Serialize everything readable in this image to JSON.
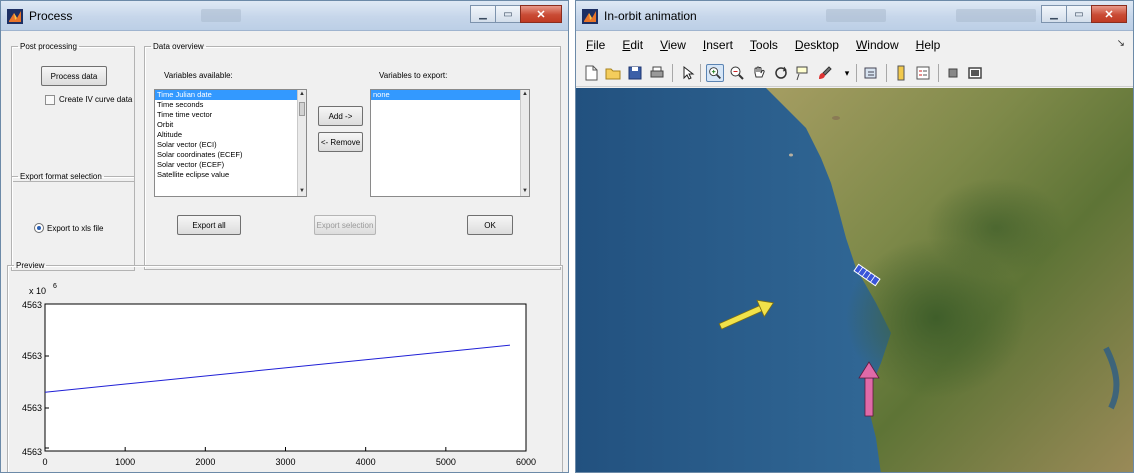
{
  "process": {
    "title": "Process",
    "post_processing": {
      "legend": "Post processing",
      "process_btn": "Process data",
      "iv_checkbox": "Create IV curve data"
    },
    "export_format": {
      "legend": "Export format selection",
      "xls_radio": "Export to xls file"
    },
    "data_overview": {
      "legend": "Data overview",
      "available_label": "Variables available:",
      "export_label": "Variables to export:",
      "available_items": [
        "Time Julian date",
        "Time seconds",
        "Time time vector",
        "Orbit",
        "Altitude",
        "Solar vector (ECI)",
        "Solar coordinates (ECEF)",
        "Solar vector (ECEF)",
        "Satellite eclipse value"
      ],
      "export_items": [
        "none"
      ],
      "add_btn": "Add ->",
      "remove_btn": "<- Remove",
      "export_all_btn": "Export all",
      "export_selection_btn": "Export selection",
      "ok_btn": "OK"
    },
    "preview": {
      "legend": "Preview",
      "exponent_base": "x 10",
      "exponent_power": "6",
      "ytick_labels": [
        "4563",
        "4563",
        "4563",
        "4563"
      ],
      "xtick_labels": [
        "0",
        "1000",
        "2000",
        "3000",
        "4000",
        "5000",
        "6000"
      ]
    }
  },
  "chart_data": {
    "type": "line",
    "x": [
      0,
      5800
    ],
    "y": [
      0.4,
      0.72
    ],
    "xlim": [
      0,
      6000
    ],
    "ylim": [
      0,
      1
    ],
    "line_color": "#1f1fd6",
    "grid": false
  },
  "animation": {
    "title": "In-orbit animation",
    "menus": [
      {
        "underline": "F",
        "rest": "ile"
      },
      {
        "underline": "E",
        "rest": "dit"
      },
      {
        "underline": "V",
        "rest": "iew"
      },
      {
        "underline": "I",
        "rest": "nsert"
      },
      {
        "underline": "T",
        "rest": "ools"
      },
      {
        "underline": "D",
        "rest": "esktop"
      },
      {
        "underline": "W",
        "rest": "indow"
      },
      {
        "underline": "H",
        "rest": "elp"
      }
    ],
    "toolbar_icons": [
      "new-file-icon",
      "open-folder-icon",
      "save-icon",
      "print-icon",
      "pointer-icon",
      "zoom-in-icon",
      "zoom-out-icon",
      "pan-icon",
      "rotate-icon",
      "data-cursor-icon",
      "brush-icon",
      "link-icon",
      "colorbar-icon",
      "legend-icon",
      "hide-tools-icon",
      "show-tools-icon"
    ],
    "colors": {
      "ocean": "#2a5f8e",
      "sun_arrow": "#f2e24a",
      "nadir_arrow": "#e06aa8",
      "satellite": "#3a55d8"
    }
  }
}
